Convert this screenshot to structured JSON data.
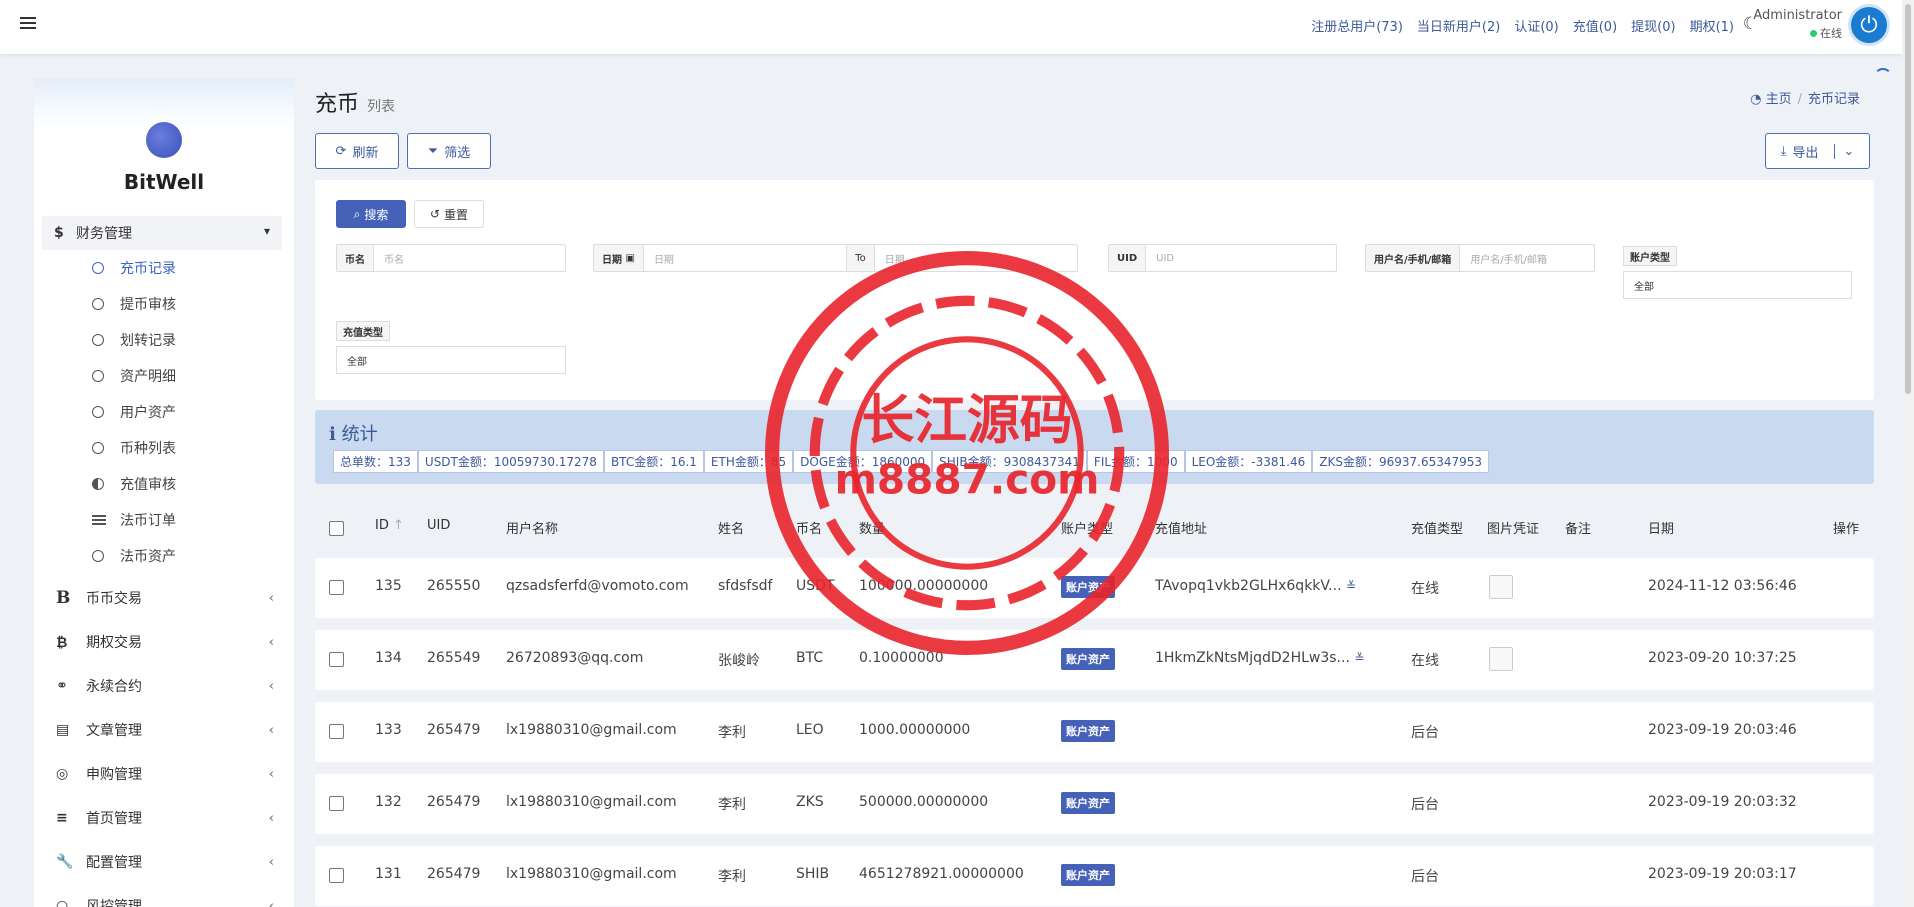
{
  "topbar": {
    "nav": [
      "注册总用户(73)",
      "当日新用户(2)",
      "认证(0)",
      "充值(0)",
      "提现(0)",
      "期权(1)"
    ],
    "user_name": "Administrator",
    "user_status": "在线"
  },
  "sidebar": {
    "brand": "BitWell",
    "group": "财务管理",
    "subitems": [
      "充币记录",
      "提币审核",
      "划转记录",
      "资产明细",
      "用户资产",
      "币种列表",
      "充值审核",
      "法币订单",
      "法币资产"
    ],
    "items": [
      "币币交易",
      "期权交易",
      "永续合约",
      "文章管理",
      "申购管理",
      "首页管理",
      "配置管理",
      "风控管理"
    ]
  },
  "page": {
    "title": "充币",
    "subtitle": "列表",
    "breadcrumb_home": "主页",
    "breadcrumb_current": "充币记录",
    "refresh": "刷新",
    "filter": "筛选",
    "export": "导出"
  },
  "filters": {
    "search": "搜索",
    "reset": "重置",
    "coin_label": "币名",
    "coin_placeholder": "币名",
    "date_label": "日期",
    "date_placeholder": "日期",
    "to": "To",
    "date_end_placeholder": "日期",
    "uid_label": "UID",
    "uid_placeholder": "UID",
    "user_label": "用户名/手机/邮箱",
    "user_placeholder": "用户名/手机/邮箱",
    "acct_type_label": "账户类型",
    "acct_type_value": "全部",
    "recharge_type_label": "充值类型",
    "recharge_type_value": "全部"
  },
  "stats": {
    "title": "统计",
    "items": [
      "总单数：133",
      "USDT金额：10059730.17278",
      "BTC金额：16.1",
      "ETH金额：85",
      "DOGE金额：1860000",
      "SHIB金额：9308437341",
      "FIL金额：1000",
      "LEO金额：-3381.46",
      "ZKS金额：96937.65347953"
    ]
  },
  "table": {
    "headers": [
      "ID",
      "UID",
      "用户名称",
      "姓名",
      "币名",
      "数量",
      "账户类型",
      "充值地址",
      "充值类型",
      "图片凭证",
      "备注",
      "日期",
      "操作"
    ],
    "rows": [
      {
        "id": "135",
        "uid": "265550",
        "user": "qzsadsferfd@vomoto.com",
        "name": "sfdsfsdf",
        "coin": "USDT",
        "qty": "100000.00000000",
        "acct": "账户资产",
        "addr": "TAvopq1vkb2GLHx6qkkV...",
        "type": "在线",
        "date": "2024-11-12 03:56:46"
      },
      {
        "id": "134",
        "uid": "265549",
        "user": "26720893@qq.com",
        "name": "张峻岭",
        "coin": "BTC",
        "qty": "0.10000000",
        "acct": "账户资产",
        "addr": "1HkmZkNtsMjqdD2HLw3s...",
        "type": "在线",
        "date": "2023-09-20 10:37:25"
      },
      {
        "id": "133",
        "uid": "265479",
        "user": "lx19880310@gmail.com",
        "name": "李利",
        "coin": "LEO",
        "qty": "1000.00000000",
        "acct": "账户资产",
        "addr": "",
        "type": "后台",
        "date": "2023-09-19 20:03:46"
      },
      {
        "id": "132",
        "uid": "265479",
        "user": "lx19880310@gmail.com",
        "name": "李利",
        "coin": "ZKS",
        "qty": "500000.00000000",
        "acct": "账户资产",
        "addr": "",
        "type": "后台",
        "date": "2023-09-19 20:03:32"
      },
      {
        "id": "131",
        "uid": "265479",
        "user": "lx19880310@gmail.com",
        "name": "李利",
        "coin": "SHIB",
        "qty": "4651278921.00000000",
        "acct": "账户资产",
        "addr": "",
        "type": "后台",
        "date": "2023-09-19 20:03:17"
      }
    ]
  },
  "watermark": {
    "line1": "长江源码",
    "line2": "m8887.com"
  },
  "colors": {
    "accent": "#4562b8",
    "link": "#3c5a9a",
    "stats_bg": "#c9d9ef",
    "watermark": "#e8242b"
  }
}
